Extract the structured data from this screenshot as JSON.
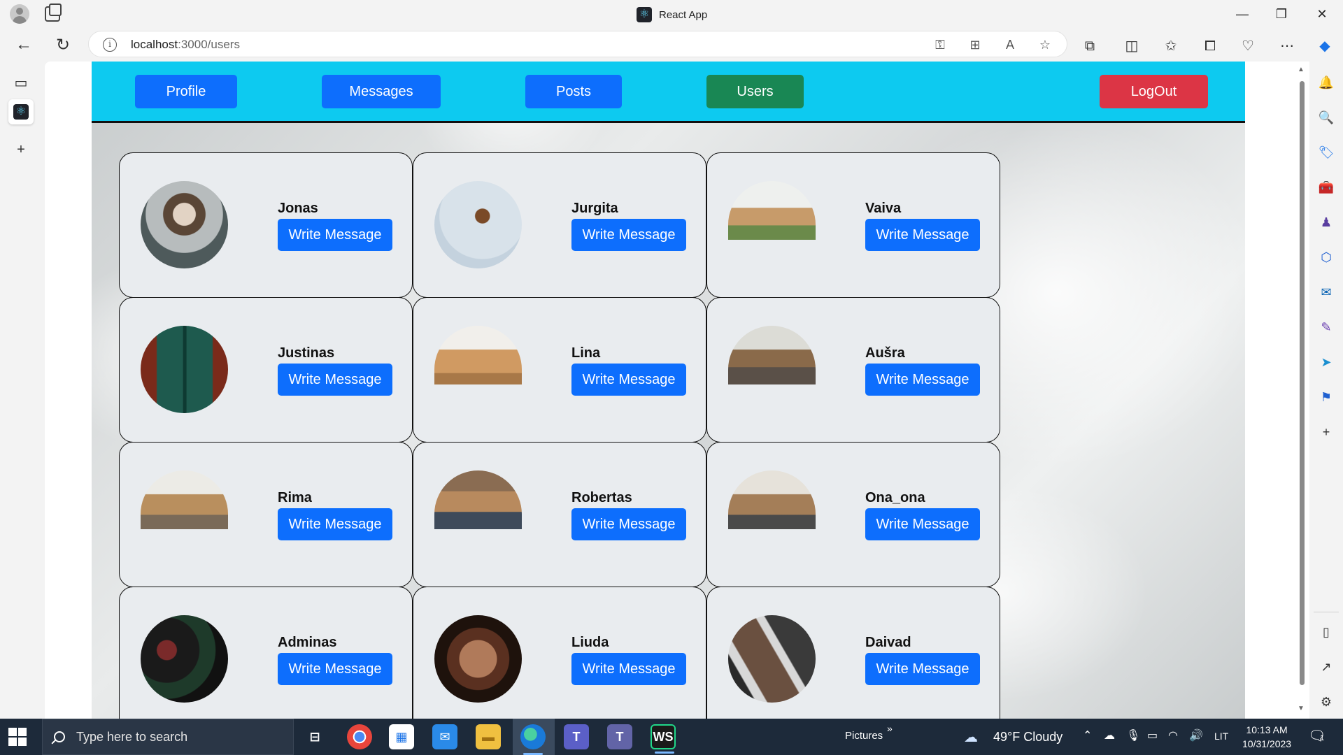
{
  "browser": {
    "window_title": "React App",
    "url_host": "localhost",
    "url_path": ":3000/users"
  },
  "navbar": {
    "profile": "Profile",
    "messages": "Messages",
    "posts": "Posts",
    "users": "Users",
    "logout": "LogOut"
  },
  "users": [
    {
      "name": "Jonas",
      "button": "Write Message"
    },
    {
      "name": "Jurgita",
      "button": "Write Message"
    },
    {
      "name": "Vaiva",
      "button": "Write Message"
    },
    {
      "name": "Justinas",
      "button": "Write Message"
    },
    {
      "name": "Lina",
      "button": "Write Message"
    },
    {
      "name": "Aušra",
      "button": "Write Message"
    },
    {
      "name": "Rima",
      "button": "Write Message"
    },
    {
      "name": "Robertas",
      "button": "Write Message"
    },
    {
      "name": "Ona_ona",
      "button": "Write Message"
    },
    {
      "name": "Adminas",
      "button": "Write Message"
    },
    {
      "name": "Liuda",
      "button": "Write Message"
    },
    {
      "name": "Daivad",
      "button": "Write Message"
    }
  ],
  "taskbar": {
    "search_placeholder": "Type here to search",
    "pictures_label": "Pictures",
    "weather": "49°F  Cloudy",
    "language": "LIT",
    "time": "10:13 AM",
    "date": "10/31/2023",
    "notification_count": "1"
  },
  "colors": {
    "navbar_bg": "#0dcaf0",
    "primary": "#0d6efd",
    "success": "#198754",
    "danger": "#dc3545"
  }
}
